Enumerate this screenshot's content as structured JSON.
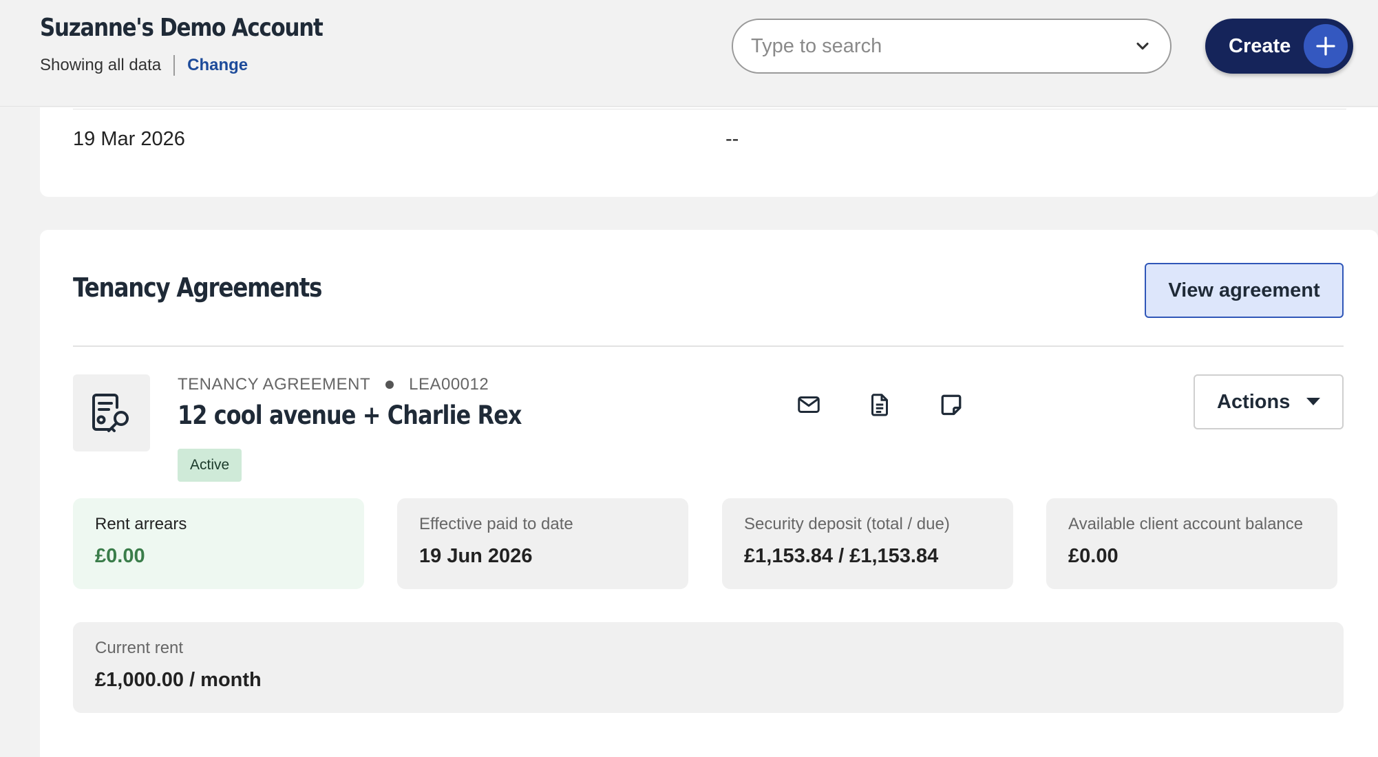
{
  "header": {
    "account_title": "Suzanne's Demo Account",
    "scope_text": "Showing all data",
    "change_link": "Change",
    "search_placeholder": "Type to search",
    "create_label": "Create"
  },
  "previous_card": {
    "left_value": "19 Mar 2026",
    "right_value": "--"
  },
  "tenancy": {
    "section_title": "Tenancy Agreements",
    "view_button": "View agreement",
    "agreement_type": "TENANCY AGREEMENT",
    "agreement_ref": "LEA00012",
    "agreement_name": "12 cool avenue + Charlie Rex",
    "status": "Active",
    "actions_label": "Actions",
    "stats": [
      {
        "label": "Rent arrears",
        "value": "£0.00"
      },
      {
        "label": "Effective paid to date",
        "value": "19 Jun 2026"
      },
      {
        "label": "Security deposit (total / due)",
        "value": "£1,153.84 / £1,153.84"
      },
      {
        "label": "Available client account balance",
        "value": "£0.00"
      }
    ],
    "current_rent": {
      "label": "Current rent",
      "value": "£1,000.00 / month"
    }
  },
  "colors": {
    "brand_navy": "#15245a",
    "brand_blue": "#3458c0",
    "link": "#1d4b9a",
    "badge_green": "#cfead8",
    "arrears_green": "#3a7d4a"
  },
  "icons": [
    "chevron-down-icon",
    "plus-icon",
    "agreement-key-icon",
    "mail-icon",
    "document-icon",
    "note-icon",
    "caret-down-icon"
  ]
}
